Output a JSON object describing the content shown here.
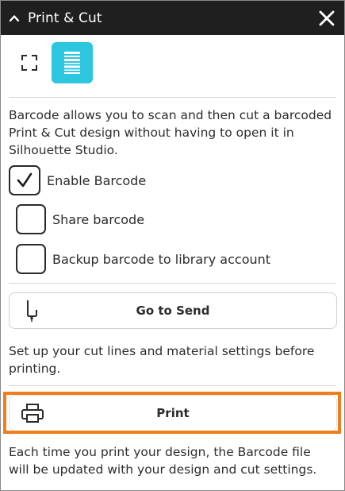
{
  "titlebar": {
    "title": "Print & Cut",
    "collapse_icon": "chevron-up-icon",
    "close_icon": "close-icon"
  },
  "modes": [
    {
      "icon": "crop-marks-icon",
      "active": false
    },
    {
      "icon": "barcode-icon",
      "active": true
    }
  ],
  "colors": {
    "titlebar_bg": "#1f1f1f",
    "active_mode": "#2cc6de",
    "highlight": "#f07d1c"
  },
  "intro_text": "Barcode allows you to scan and then cut a barcoded Print & Cut design without having to open it in Silhouette Studio.",
  "options": [
    {
      "label": "Enable Barcode",
      "checked": true
    },
    {
      "label": "Share barcode",
      "checked": false
    },
    {
      "label": "Backup barcode to library account",
      "checked": false
    }
  ],
  "send_button": {
    "label": "Go to Send",
    "icon": "cutter-blade-icon"
  },
  "send_hint": "Set up your cut lines and material settings before printing.",
  "print_button": {
    "label": "Print",
    "icon": "printer-icon"
  },
  "print_hint": "Each time you print your design, the Barcode file will be updated with your design and cut settings."
}
